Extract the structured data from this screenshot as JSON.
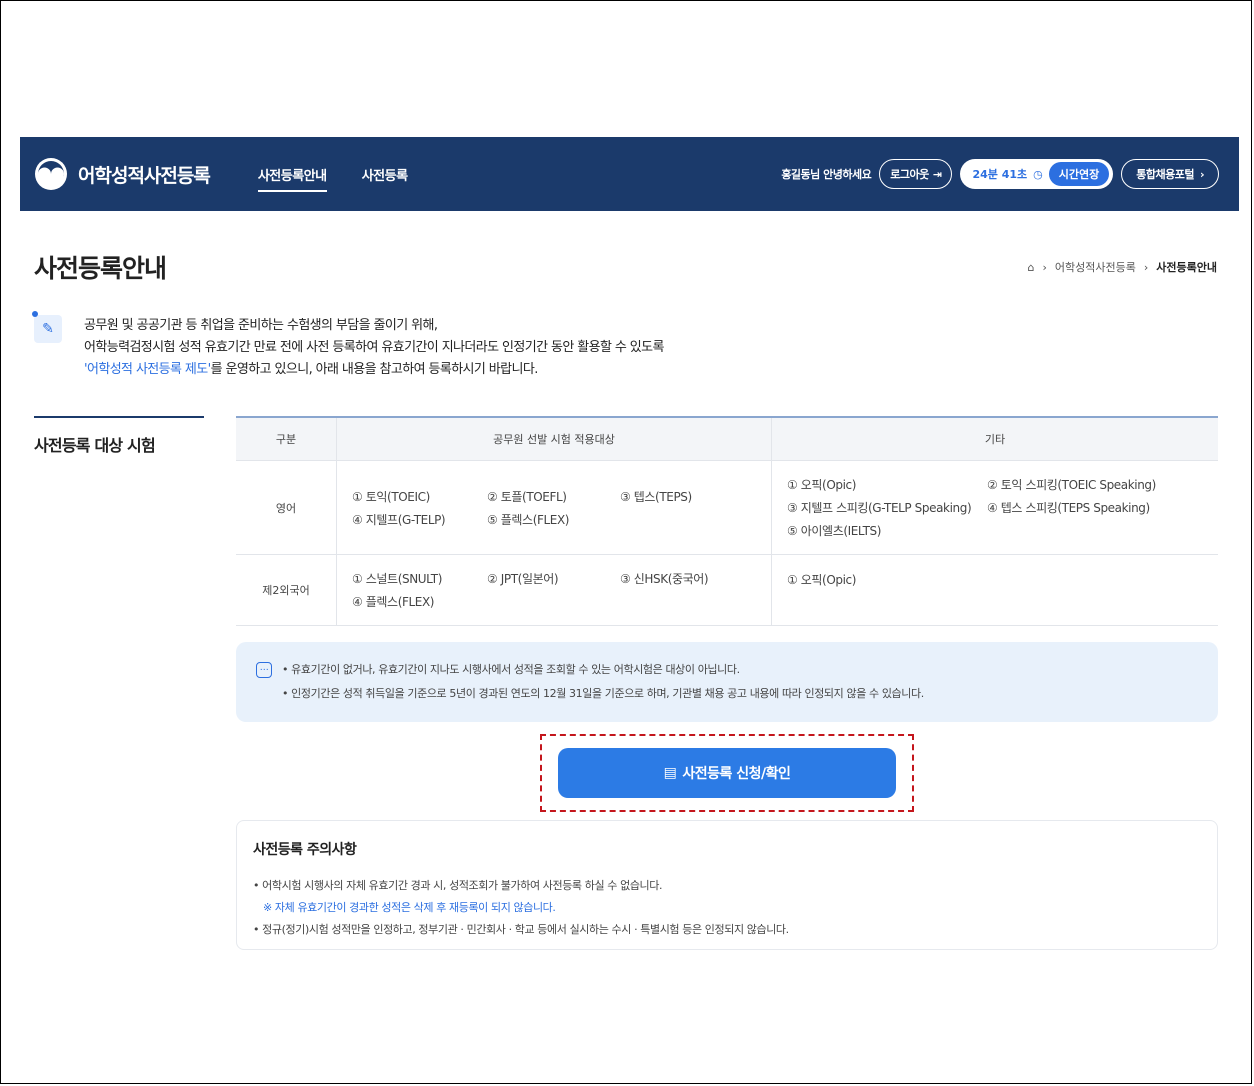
{
  "header": {
    "logo_text": "어학성적사전등록",
    "nav": [
      "사전등록안내",
      "사전등록"
    ],
    "greeting": "홍길동님 안녕하세요",
    "logout_label": "로그아웃",
    "timer": "24분 41초",
    "extend_label": "시간연장",
    "portal_label": "통합채용포털"
  },
  "page": {
    "title": "사전등록안내",
    "breadcrumb": [
      "어학성적사전등록",
      "사전등록안내"
    ]
  },
  "intro": {
    "line1": "공무원 및 공공기관 등 취업을 준비하는 수험생의 부담을 줄이기 위해,",
    "line2": "어학능력검정시험 성적 유효기간 만료 전에 사전 등록하여 유효기간이 지나더라도 인정기간 동안 활용할 수 있도록",
    "highlight": "'어학성적 사전등록 제도'",
    "line3_rest": "를 운영하고 있으니, 아래 내용을 참고하여 등록하시기 바랍니다."
  },
  "section": {
    "title": "사전등록 대상 시험",
    "headers": [
      "구분",
      "공무원 선발 시험 적용대상",
      "기타"
    ],
    "rows": [
      {
        "category": "영어",
        "gov": [
          "① 토익(TOEIC)",
          "② 토플(TOEFL)",
          "③ 텝스(TEPS)",
          "④ 지텔프(G-TELP)",
          "⑤ 플렉스(FLEX)"
        ],
        "etc": [
          "① 오픽(Opic)",
          "② 토익 스피킹(TOEIC Speaking)",
          "③ 지텔프 스피킹(G-TELP Speaking)",
          "④ 텝스 스피킹(TEPS Speaking)",
          "⑤ 아이엘츠(IELTS)"
        ]
      },
      {
        "category": "제2외국어",
        "gov": [
          "① 스널트(SNULT)",
          "② JPT(일본어)",
          "③ 신HSK(중국어)",
          "④ 플렉스(FLEX)"
        ],
        "etc": [
          "① 오픽(Opic)"
        ]
      }
    ]
  },
  "notes": [
    "• 유효기간이 없거나, 유효기간이 지나도 시행사에서 성적을 조회할 수 있는 어학시험은 대상이 아닙니다.",
    "• 인정기간은 성적 취득일을 기준으로 5년이 경과된 연도의 12월 31일을 기준으로 하며, 기관별 채용 공고 내용에 따라 인정되지 않을 수 있습니다."
  ],
  "register_button": "사전등록 신청/확인",
  "caution": {
    "title": "사전등록 주의사항",
    "items": [
      "• 어학시험 시행사의 자체 유효기간 경과 시, 성적조회가 불가하여 사전등록 하실 수 없습니다.",
      "※ 자체 유효기간이 경과한 성적은 삭제 후 재등록이 되지 않습니다.",
      "• 정규(정기)시험 성적만을 인정하고, 정부기관 · 민간회사 · 학교 등에서 실시하는 수시 · 특별시험 등은 인정되지 않습니다."
    ]
  },
  "colors": {
    "header_bg": "#1b3a6b",
    "accent": "#2c6fe0",
    "highlight_border": "#c4161c"
  }
}
